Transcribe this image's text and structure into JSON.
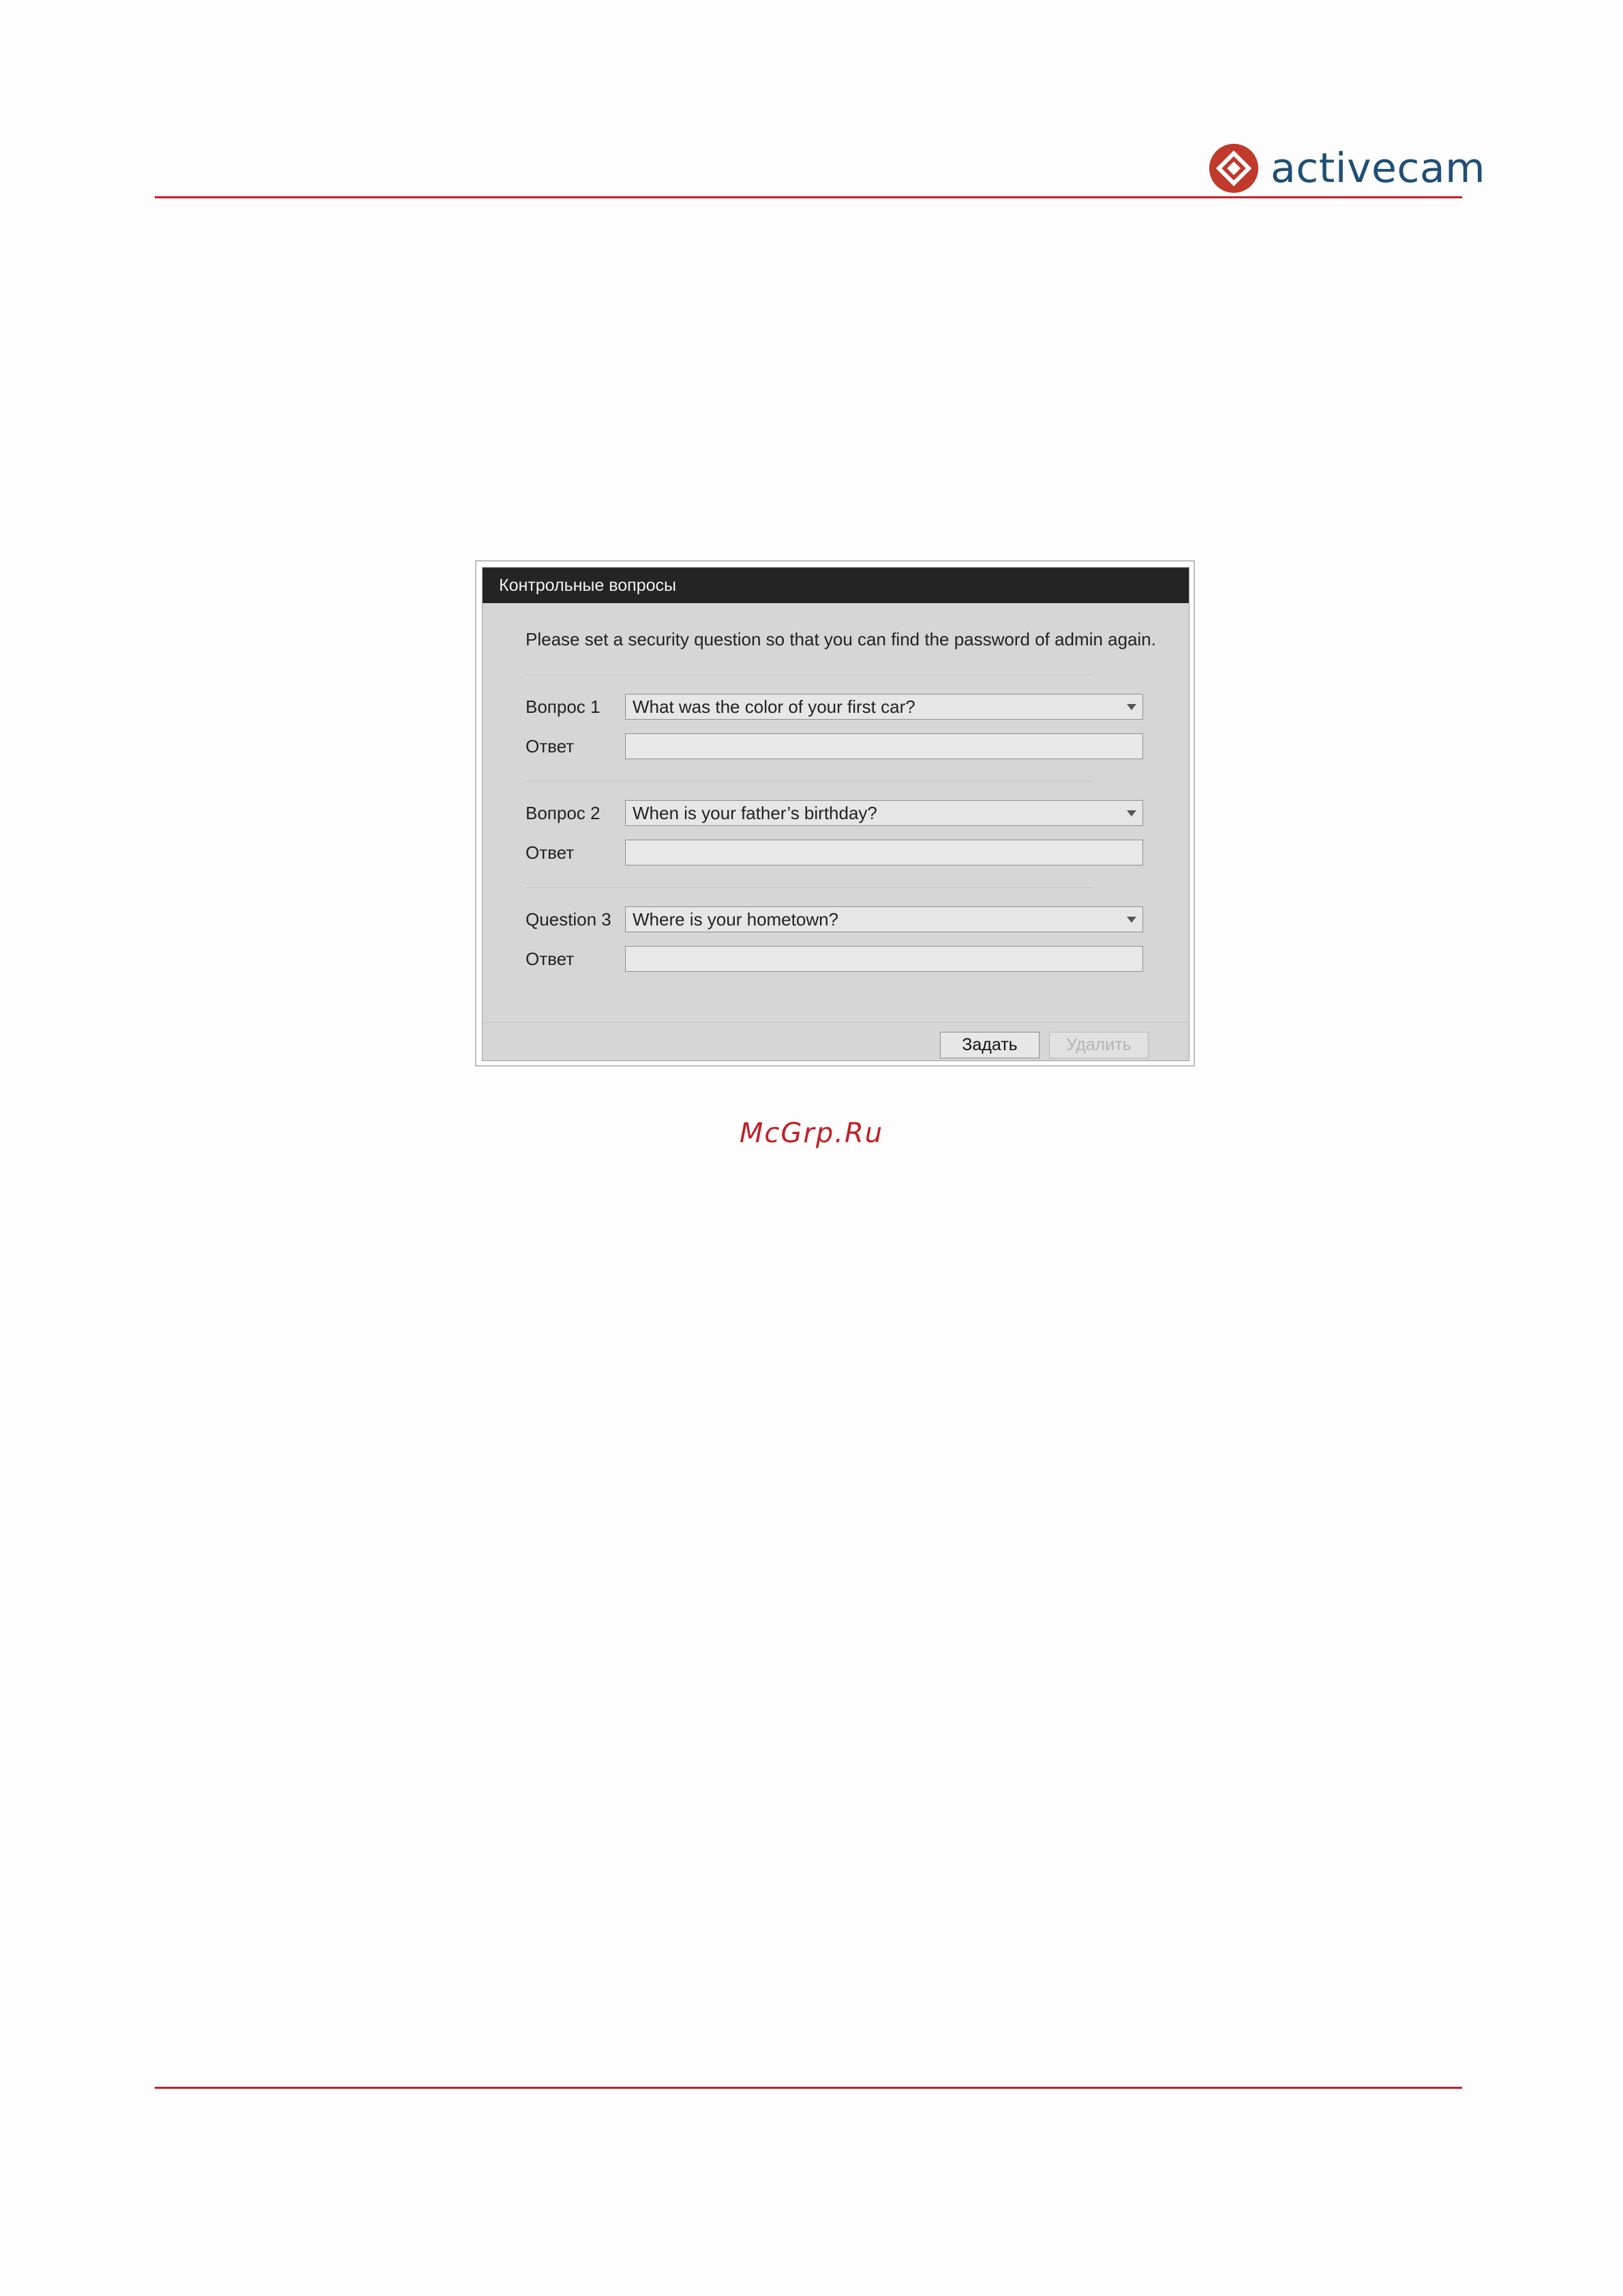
{
  "brand": {
    "name": "activecam",
    "logo_color": "#c0392b",
    "text_color": "#1f4f74",
    "rule_color": "#c81e2a"
  },
  "dialog": {
    "title": "Контрольные вопросы",
    "intro": "Please set a security question so that you can find the password of admin again.",
    "questions": [
      {
        "label": "Вопрос 1",
        "selected": "What was the color of your first car?",
        "answer_label": "Ответ",
        "answer_value": ""
      },
      {
        "label": "Вопрос 2",
        "selected": "When is your father’s birthday?",
        "answer_label": "Ответ",
        "answer_value": ""
      },
      {
        "label": "Question 3",
        "selected": "Where is your hometown?",
        "answer_label": "Ответ",
        "answer_value": ""
      }
    ],
    "buttons": {
      "set": "Задать",
      "delete": "Удалить"
    }
  },
  "watermark": "McGrp.Ru"
}
